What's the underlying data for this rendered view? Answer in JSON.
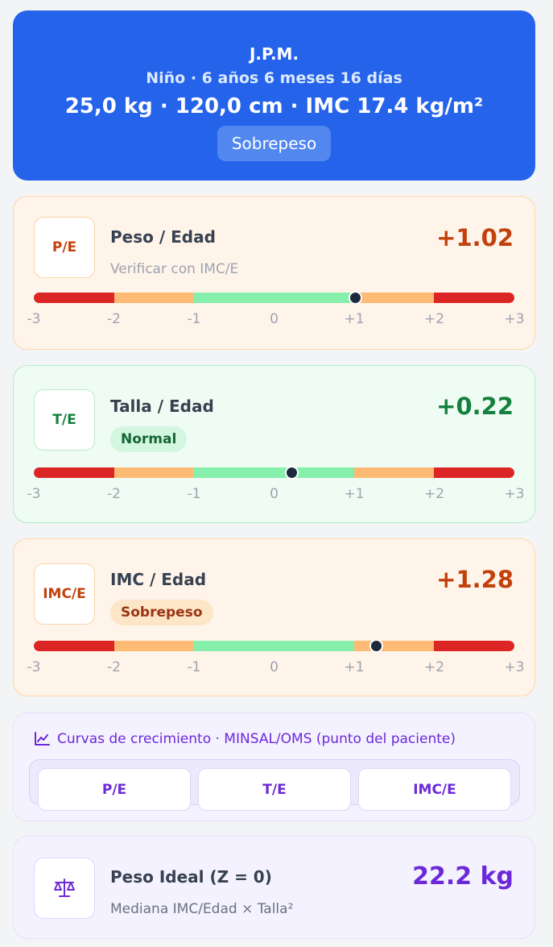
{
  "patient": {
    "initials": "J.P.M.",
    "subtitle": "Niño · 6 años 6 meses 16 días",
    "measures": "25,0 kg · 120,0 cm · IMC 17.4 kg/m²",
    "status": "Sobrepeso"
  },
  "scale_ticks": [
    "-3",
    "-2",
    "-1",
    "0",
    "+1",
    "+2",
    "+3"
  ],
  "indicators": [
    {
      "code": "P/E",
      "title": "Peso / Edad",
      "note": "Verificar con IMC/E",
      "z_label": "+1.02",
      "z": 1.02,
      "tone": "warn"
    },
    {
      "code": "T/E",
      "title": "Talla / Edad",
      "badge": "Normal",
      "z_label": "+0.22",
      "z": 0.22,
      "tone": "ok"
    },
    {
      "code": "IMC/E",
      "title": "IMC / Edad",
      "badge": "Sobrepeso",
      "z_label": "+1.28",
      "z": 1.28,
      "tone": "warn"
    }
  ],
  "curves": {
    "title": "Curvas de crecimiento · MINSAL/OMS (punto del paciente)",
    "icon": "line-chart-icon",
    "tabs": [
      "P/E",
      "T/E",
      "IMC/E"
    ]
  },
  "ideal": {
    "icon": "scale-icon",
    "title": "Peso Ideal (Z = 0)",
    "note": "Mediana IMC/Edad × Talla²",
    "value": "22.2 kg"
  },
  "colors": {
    "header_bg": "#2563eb",
    "severe": "#dc2626",
    "risk": "#fdba74",
    "normal": "#86efac",
    "accent_purple": "#6d28d9"
  }
}
